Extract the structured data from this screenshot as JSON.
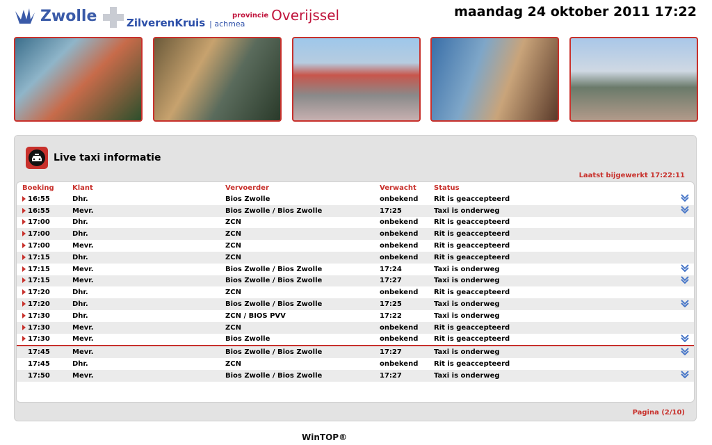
{
  "header": {
    "logo_zwolle": "Zwolle",
    "logo_zk_main": "ZilverenKruis",
    "logo_zk_sub": "| achmea",
    "logo_prov": "provincie",
    "logo_ov": "Overijssel",
    "datetime": "maandag 24 oktober 2011 17:22"
  },
  "panel": {
    "title": "Live taxi informatie",
    "updated": "Laatst bijgewerkt 17:22:11",
    "pagination": "Pagina (2/10)"
  },
  "table": {
    "headers": [
      "Boeking",
      "Klant",
      "Vervoerder",
      "Verwacht",
      "Status"
    ],
    "rows": [
      {
        "boeking": "16:55",
        "klant": "Dhr.",
        "vervoerder": "Bios Zwolle",
        "verwacht": "onbekend",
        "status": "Rit is geaccepteerd",
        "marker": true,
        "icon": true
      },
      {
        "boeking": "16:55",
        "klant": "Mevr.",
        "vervoerder": "Bios Zwolle / Bios Zwolle",
        "verwacht": "17:25",
        "status": "Taxi is onderweg",
        "marker": true,
        "icon": true
      },
      {
        "boeking": "17:00",
        "klant": "Dhr.",
        "vervoerder": "ZCN",
        "verwacht": "onbekend",
        "status": "Rit is geaccepteerd",
        "marker": true,
        "icon": false
      },
      {
        "boeking": "17:00",
        "klant": "Dhr.",
        "vervoerder": "ZCN",
        "verwacht": "onbekend",
        "status": "Rit is geaccepteerd",
        "marker": true,
        "icon": false
      },
      {
        "boeking": "17:00",
        "klant": "Mevr.",
        "vervoerder": "ZCN",
        "verwacht": "onbekend",
        "status": "Rit is geaccepteerd",
        "marker": true,
        "icon": false
      },
      {
        "boeking": "17:15",
        "klant": "Dhr.",
        "vervoerder": "ZCN",
        "verwacht": "onbekend",
        "status": "Rit is geaccepteerd",
        "marker": true,
        "icon": false
      },
      {
        "boeking": "17:15",
        "klant": "Mevr.",
        "vervoerder": "Bios Zwolle / Bios Zwolle",
        "verwacht": "17:24",
        "status": "Taxi is onderweg",
        "marker": true,
        "icon": true
      },
      {
        "boeking": "17:15",
        "klant": "Mevr.",
        "vervoerder": "Bios Zwolle / Bios Zwolle",
        "verwacht": "17:27",
        "status": "Taxi is onderweg",
        "marker": true,
        "icon": true
      },
      {
        "boeking": "17:20",
        "klant": "Dhr.",
        "vervoerder": "ZCN",
        "verwacht": "onbekend",
        "status": "Rit is geaccepteerd",
        "marker": true,
        "icon": false
      },
      {
        "boeking": "17:20",
        "klant": "Dhr.",
        "vervoerder": "Bios Zwolle / Bios Zwolle",
        "verwacht": "17:25",
        "status": "Taxi is onderweg",
        "marker": true,
        "icon": true
      },
      {
        "boeking": "17:30",
        "klant": "Dhr.",
        "vervoerder": "ZCN / BIOS PVV",
        "verwacht": "17:22",
        "status": "Taxi is onderweg",
        "marker": true,
        "icon": false
      },
      {
        "boeking": "17:30",
        "klant": "Mevr.",
        "vervoerder": "ZCN",
        "verwacht": "onbekend",
        "status": "Rit is geaccepteerd",
        "marker": true,
        "icon": false
      },
      {
        "boeking": "17:30",
        "klant": "Mevr.",
        "vervoerder": "Bios Zwolle",
        "verwacht": "onbekend",
        "status": "Rit is geaccepteerd",
        "marker": true,
        "icon": true,
        "separator": true
      },
      {
        "boeking": "17:45",
        "klant": "Mevr.",
        "vervoerder": "Bios Zwolle / Bios Zwolle",
        "verwacht": "17:27",
        "status": "Taxi is onderweg",
        "marker": false,
        "icon": true
      },
      {
        "boeking": "17:45",
        "klant": "Dhr.",
        "vervoerder": "ZCN",
        "verwacht": "onbekend",
        "status": "Rit is geaccepteerd",
        "marker": false,
        "icon": false
      },
      {
        "boeking": "17:50",
        "klant": "Mevr.",
        "vervoerder": "Bios Zwolle / Bios Zwolle",
        "verwacht": "17:27",
        "status": "Taxi is onderweg",
        "marker": false,
        "icon": true
      }
    ]
  },
  "footer": {
    "brand": "WinTOP®"
  },
  "colors": {
    "accent": "#c8312c",
    "brand_blue": "#3a5aa8",
    "arrow_blue": "#4a78c8"
  }
}
